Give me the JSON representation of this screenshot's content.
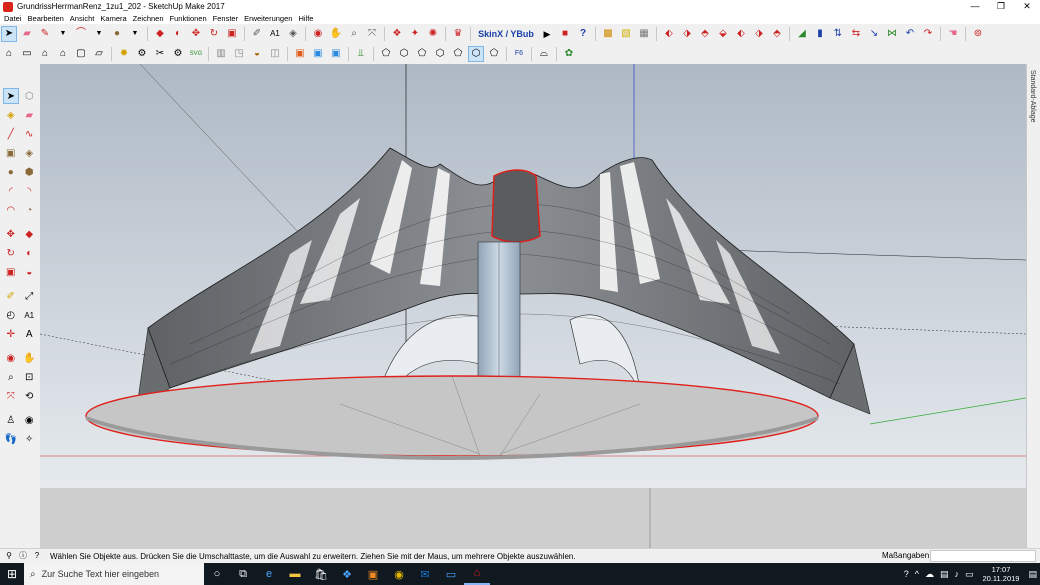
{
  "window": {
    "title": "GrundrissHerrmanRenz_1zu1_202 - SketchUp Make 2017",
    "min_icon": "minimize-icon",
    "max_icon": "restore-icon",
    "close_icon": "close-icon"
  },
  "menu": {
    "items": [
      "Datei",
      "Bearbeiten",
      "Ansicht",
      "Kamera",
      "Zeichnen",
      "Funktionen",
      "Fenster",
      "Erweiterungen",
      "Hilfe"
    ]
  },
  "toolbar1": {
    "skin_label": "SkinX / YBub"
  },
  "toolbar2": {
    "svg_label": "SVG"
  },
  "right_tray": {
    "label": "Standard-Ablage"
  },
  "status": {
    "message": "Wählen Sie Objekte aus. Drücken Sie die Umschalttaste, um die Auswahl zu erweitern. Ziehen Sie mit der Maus, um mehrere Objekte auszuwählen.",
    "measure_label": "Maßangaben",
    "measure_value": ""
  },
  "taskbar": {
    "search_placeholder": "Zur Suche Text hier eingeben",
    "time": "17:07",
    "date": "20.11.2019"
  },
  "colors": {
    "accent": "#d9261c",
    "sky_top": "#aeb9c5",
    "sky_bottom": "#e6eaee",
    "ground": "#cfcfcf",
    "selection": "#e0201a"
  }
}
